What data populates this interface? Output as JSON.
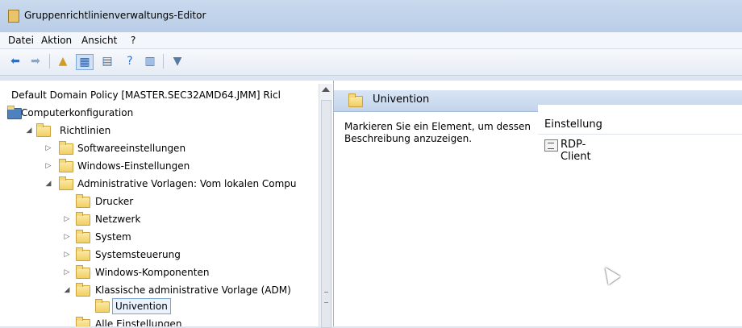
{
  "window": {
    "title": "Gruppenrichtlinienverwaltungs-Editor"
  },
  "menu": [
    "Datei",
    "Aktion",
    "Ansicht",
    "?"
  ],
  "toolbar": {
    "icons": [
      "back-icon",
      "forward-icon",
      "up-folder-icon",
      "show-hide-console-tree-icon",
      "export-list-icon",
      "help-icon",
      "show-hide-action-pane-icon",
      "filter-icon"
    ]
  },
  "tree": {
    "root": "Default Domain Policy [MASTER.SEC32AMD64.JMM] Ricl",
    "computer": "Computerkonfiguration",
    "richtlinien": "Richtlinien",
    "software": "Softwareeinstellungen",
    "windows": "Windows-Einstellungen",
    "admin": "Administrative Vorlagen: Vom lokalen Compu",
    "drucker": "Drucker",
    "netzwerk": "Netzwerk",
    "system": "System",
    "systemsteuerung": "Systemsteuerung",
    "komponenten": "Windows-Komponenten",
    "klassisch": "Klassische administrative Vorlage (ADM)",
    "univention": "Univention",
    "alle": "Alle Einstellungen"
  },
  "details": {
    "header": "Univention",
    "description": "Markieren Sie ein Element, um dessen Beschreibung anzuzeigen.",
    "column": "Einstellung",
    "items": [
      "RDP-Client"
    ]
  }
}
